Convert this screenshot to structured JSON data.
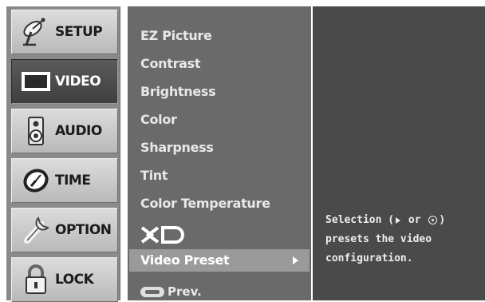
{
  "categories": [
    {
      "label": "SETUP",
      "icon": "satellite-dish-icon"
    },
    {
      "label": "VIDEO",
      "icon": "tv-screen-icon",
      "active": true
    },
    {
      "label": "AUDIO",
      "icon": "speaker-icon"
    },
    {
      "label": "TIME",
      "icon": "clock-icon"
    },
    {
      "label": "OPTION",
      "icon": "wrench-icon"
    },
    {
      "label": "LOCK",
      "icon": "padlock-icon"
    }
  ],
  "submenu": {
    "items": [
      "EZ Picture",
      "Contrast",
      "Brightness",
      "Color",
      "Sharpness",
      "Tint",
      "Color Temperature"
    ],
    "xd_logo": "XD",
    "selected_item": "Video Preset",
    "prev_label": "Prev."
  },
  "info": {
    "line1_a": "Selection (",
    "line1_b": "or",
    "line1_c": ")",
    "line2": "presets the video",
    "line3": "configuration."
  },
  "colors": {
    "category_bg": "#c8c8c8",
    "category_active_bg": "#4a4a4a",
    "submenu_bg": "#6a6a6a",
    "selected_bar": "#9a9a9a",
    "info_bg": "#4a4a4a"
  }
}
